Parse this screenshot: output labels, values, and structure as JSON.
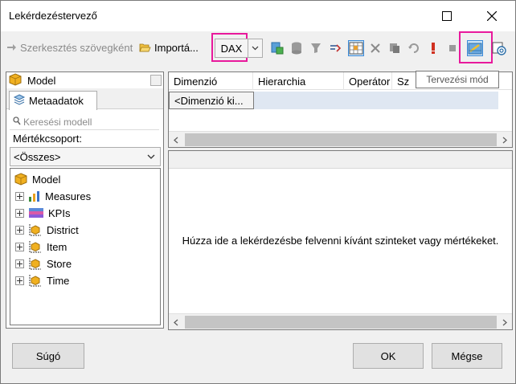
{
  "window": {
    "title": "Lekérdezéstervező"
  },
  "toolbar": {
    "edit_as_text": "Szerkesztés szövegként",
    "import": "Importá...",
    "language": "DAX"
  },
  "tooltip": {
    "design_mode": "Tervezési mód"
  },
  "left_panel": {
    "cube": "Model",
    "tab_label": "Metaadatok",
    "search_placeholder": "Keresési modell",
    "measure_group_label": "Mértékcsoport:",
    "measure_group_value": "<Összes>",
    "tree": [
      {
        "label": "Model",
        "icon": "cube-icon",
        "expandable": false
      },
      {
        "label": "Measures",
        "icon": "measures-icon",
        "expandable": true
      },
      {
        "label": "KPIs",
        "icon": "kpi-icon",
        "expandable": true
      },
      {
        "label": "District",
        "icon": "dimension-icon",
        "expandable": true
      },
      {
        "label": "Item",
        "icon": "dimension-icon",
        "expandable": true
      },
      {
        "label": "Store",
        "icon": "dimension-icon",
        "expandable": true
      },
      {
        "label": "Time",
        "icon": "dimension-icon",
        "expandable": true
      }
    ]
  },
  "filter_grid": {
    "columns": [
      "Dimenzió",
      "Hierarchia",
      "Operátor",
      "Sz"
    ],
    "row_dimension": "<Dimenzió ki..."
  },
  "results": {
    "hint": "Húzza ide a lekérdezésbe felvenni kívánt szinteket vagy mértékeket."
  },
  "buttons": {
    "help": "Súgó",
    "ok": "OK",
    "cancel": "Mégse"
  },
  "colors": {
    "highlight": "#e8199c",
    "selection": "#cce4f7"
  }
}
